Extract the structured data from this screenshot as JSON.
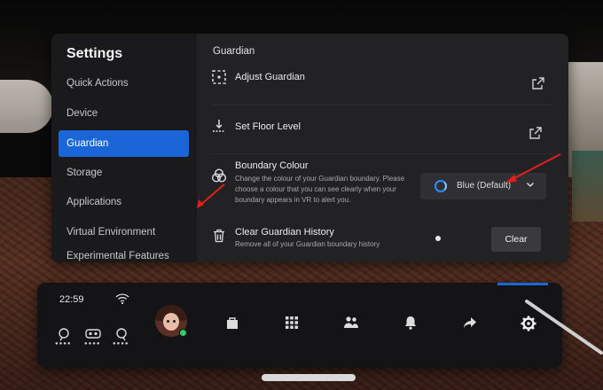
{
  "settings": {
    "title": "Settings",
    "nav": [
      {
        "label": "Quick Actions",
        "active": false
      },
      {
        "label": "Device",
        "active": false
      },
      {
        "label": "Guardian",
        "active": true
      },
      {
        "label": "Storage",
        "active": false
      },
      {
        "label": "Applications",
        "active": false
      },
      {
        "label": "Virtual Environment",
        "active": false
      },
      {
        "label": "Experimental Features",
        "active": false
      }
    ]
  },
  "guardian": {
    "section_title": "Guardian",
    "adjust": {
      "label": "Adjust Guardian",
      "icon": "adjust-guardian-icon"
    },
    "floor": {
      "label": "Set Floor Level",
      "icon": "floor-level-icon"
    },
    "boundary": {
      "label": "Boundary Colour",
      "description": "Change the colour of your Guardian boundary. Please choose a colour that you can see clearly when your boundary appears in VR to alert you.",
      "selected": "Blue (Default)",
      "icon": "boundary-colour-icon"
    },
    "clear_history": {
      "label": "Clear Guardian History",
      "description": "Remove all of your Guardian boundary history",
      "button": "Clear",
      "icon": "trash-icon"
    }
  },
  "dock": {
    "time": "22:59",
    "icons": [
      "store-icon",
      "apps-grid-icon",
      "people-icon",
      "notifications-icon",
      "share-icon",
      "settings-gear-icon"
    ]
  },
  "colors": {
    "accent": "#1a66d9",
    "annotation": "#e0201c",
    "online": "#2bd16b"
  }
}
